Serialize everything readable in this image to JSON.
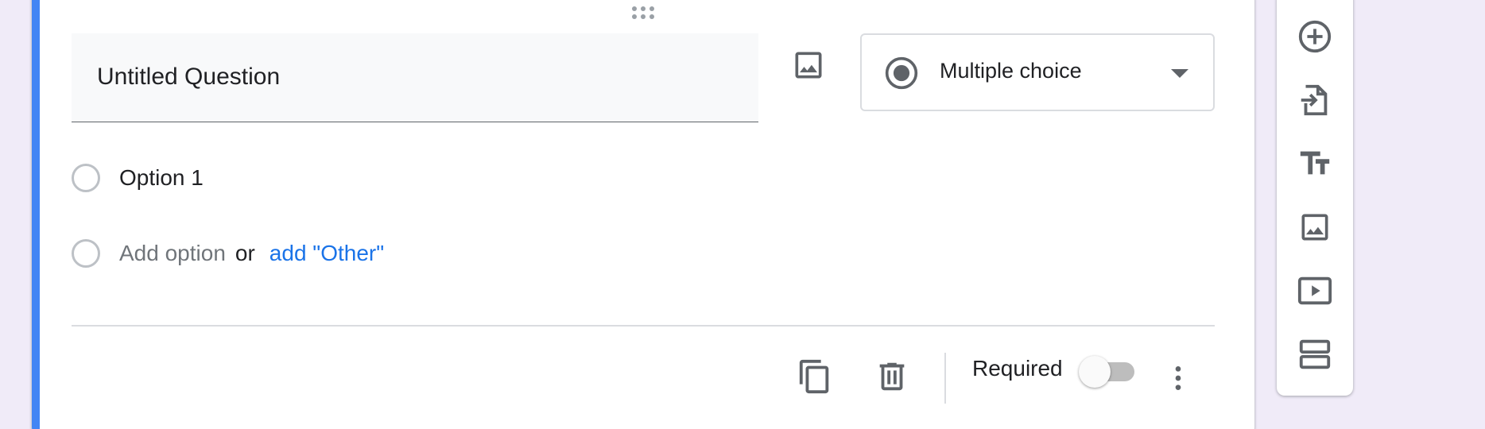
{
  "question": {
    "title": "Untitled Question",
    "type": "Multiple choice"
  },
  "options": [
    {
      "label": "Option 1"
    }
  ],
  "add_option": {
    "placeholder": "Add option",
    "or_text": "or",
    "other_link": "add \"Other\""
  },
  "footer": {
    "required_label": "Required",
    "required_on": false
  },
  "icons": {
    "question_image": "image-icon",
    "type_radio": "radio-checked-icon",
    "type_caret": "caret-down-icon",
    "duplicate": "copy-icon",
    "delete": "trash-icon",
    "more": "more-vert-icon",
    "toolbar": [
      "add-circle-icon",
      "import-questions-icon",
      "title-text-icon",
      "image-icon",
      "video-icon",
      "section-icon"
    ]
  },
  "colors": {
    "accent": "#4285f4",
    "link": "#1a73e8",
    "background": "#f0ebf8",
    "icon": "#5f6368"
  }
}
